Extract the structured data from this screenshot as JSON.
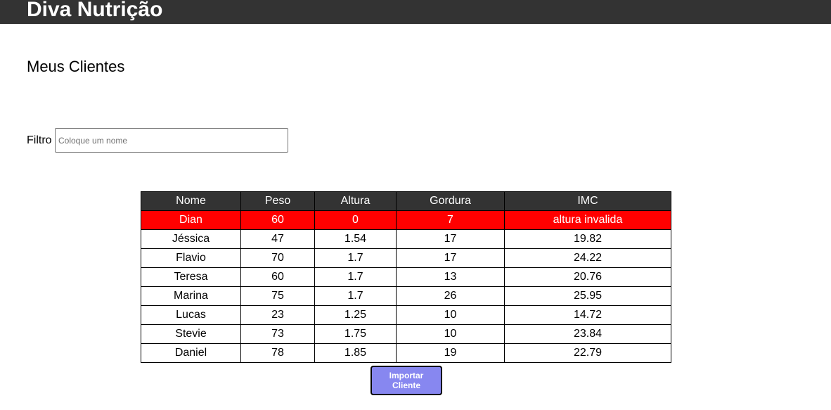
{
  "header": {
    "title": "Diva Nutrição"
  },
  "main": {
    "page_title": "Meus Clientes",
    "filter": {
      "label": "Filtro",
      "placeholder": "Coloque um nome",
      "value": ""
    },
    "table": {
      "columns": [
        "Nome",
        "Peso",
        "Altura",
        "Gordura",
        "IMC"
      ],
      "rows": [
        [
          "Dian",
          "60",
          "0",
          "7",
          "altura invalida"
        ],
        [
          "Jéssica",
          "47",
          "1.54",
          "17",
          "19.82"
        ],
        [
          "Flavio",
          "70",
          "1.7",
          "17",
          "24.22"
        ],
        [
          "Teresa",
          "60",
          "1.7",
          "13",
          "20.76"
        ],
        [
          "Marina",
          "75",
          "1.7",
          "26",
          "25.95"
        ],
        [
          "Lucas",
          "23",
          "1.25",
          "10",
          "14.72"
        ],
        [
          "Stevie",
          "73",
          "1.75",
          "10",
          "23.84"
        ],
        [
          "Daniel",
          "78",
          "1.85",
          "19",
          "22.79"
        ]
      ]
    },
    "import_button_label": "Importar Cliente"
  },
  "colors": {
    "header_bg": "#333333",
    "invalid_row_bg": "#ff0000",
    "button_bg": "#8787f0"
  }
}
